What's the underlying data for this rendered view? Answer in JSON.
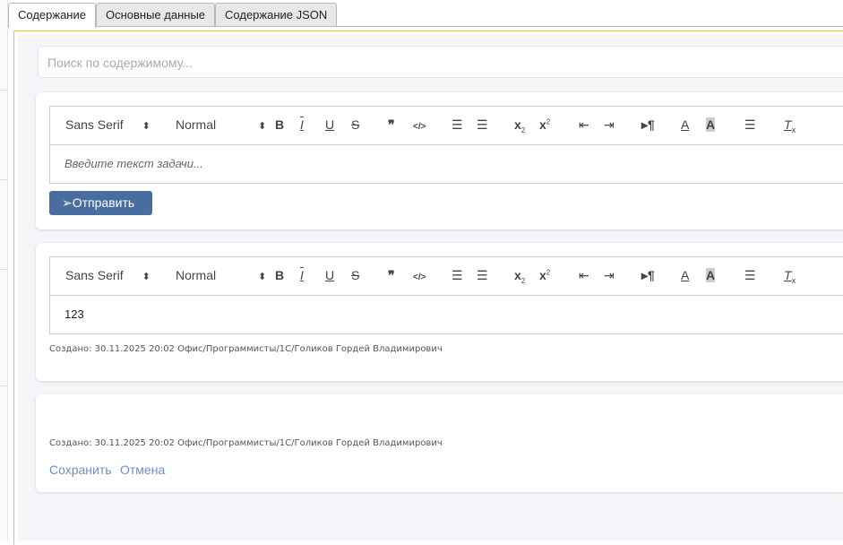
{
  "tabs": [
    "Содержание",
    "Основные данные",
    "Содержание JSON"
  ],
  "search": {
    "placeholder": "Поиск по содержимому..."
  },
  "toolbar": {
    "font": "Sans Serif",
    "size": "Normal"
  },
  "new_task": {
    "placeholder": "Введите текст задачи...",
    "send_label": "Отправить"
  },
  "comment1": {
    "text": "123",
    "meta": "Создано: 30.11.2025 20:02 Офис/Программисты/1С/Голиков Гордей Владимирович"
  },
  "comment2": {
    "text": "",
    "meta": "Создано: 30.11.2025 20:02 Офис/Программисты/1С/Голиков Гордей Владимирович",
    "save_label": "Сохранить",
    "cancel_label": "Отмена"
  },
  "colors": {
    "accent": "#4a6da1",
    "link": "#6a8fc4",
    "frame": "#f0c419"
  }
}
